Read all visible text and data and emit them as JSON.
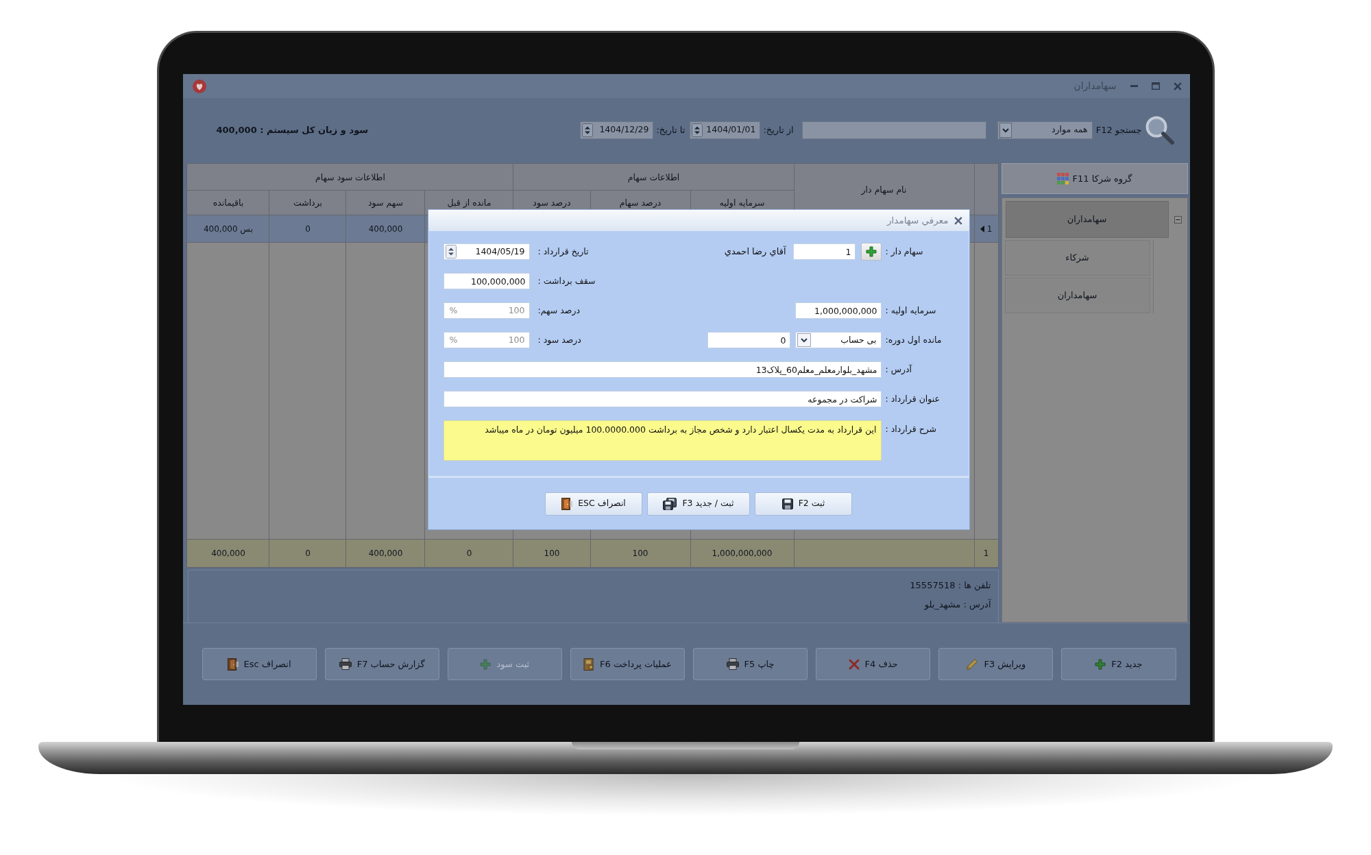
{
  "window": {
    "title": "سهامداران"
  },
  "toolbar": {
    "search_label": "جستجو F12",
    "scope": "همه موارد",
    "from_label": "از تاریخ:",
    "from_date": "1404/01/01",
    "to_label": "تا تاریخ:",
    "to_date": "1404/12/29",
    "total": "سود و زیان کل سیستم : 400,000"
  },
  "sidebar": {
    "header": "گروه شرکا F11",
    "items": [
      {
        "label": "سهامداران",
        "selected": true,
        "expanded": true,
        "children": [
          {
            "label": "شرکاء",
            "selected": false
          },
          {
            "label": "سهامداران",
            "selected": false
          }
        ]
      }
    ]
  },
  "table": {
    "name_column": "نام سهام دار",
    "groups": [
      {
        "label": "اطلاعات سهام",
        "columns": [
          "سرمایه اولیه",
          "درصد سهام",
          "درصد سود"
        ]
      },
      {
        "label": "اطلاعات سود سهام",
        "columns": [
          "مانده از قبل",
          "سهم سود",
          "برداشت",
          "باقیمانده"
        ]
      }
    ],
    "rows": [
      {
        "number": "1",
        "selected": true,
        "cells": [
          "400,000",
          "0",
          "400,000 بس"
        ]
      }
    ],
    "totals": {
      "number": "1",
      "cells": [
        "1,000,000,000",
        "100",
        "100",
        "0",
        "400,000",
        "0",
        "400,000"
      ]
    }
  },
  "info": [
    "تلفن ها : 15557518",
    "آدرس : مشهد_بلو"
  ],
  "actions": [
    {
      "label": "جدید F2",
      "kind": "add",
      "disabled": false
    },
    {
      "label": "ویرایش F3",
      "kind": "edit",
      "disabled": false
    },
    {
      "label": "حذف F4",
      "kind": "delete",
      "disabled": false
    },
    {
      "label": "چاپ F5",
      "kind": "print",
      "disabled": false
    },
    {
      "label": "عملیات پرداخت F6",
      "kind": "payment",
      "disabled": false
    },
    {
      "label": "ثبت سود",
      "kind": "add",
      "disabled": true
    },
    {
      "label": "گزارش حساب F7",
      "kind": "print",
      "disabled": false
    },
    {
      "label": "انصراف Esc",
      "kind": "exit",
      "disabled": false
    }
  ],
  "dialog": {
    "title": "معرفي سهامدار",
    "shareholder": {
      "label": "سهام دار :",
      "code": "1",
      "name": "آقاي رضا احمدي"
    },
    "contract_date": {
      "label": "تاریخ قرارداد :",
      "value": "1404/05/19"
    },
    "withdrawal_cap": {
      "label": "سقف برداشت :",
      "value": "100,000,000"
    },
    "initial_capital": {
      "label": "سرمایه اولیه :",
      "value": "1,000,000,000"
    },
    "share_percent": {
      "label": "درصد سهم:",
      "value": "100",
      "unit": "%",
      "disabled": true
    },
    "opening_balance": {
      "label": "مانده اول دوره:",
      "account_type": "بی حساب",
      "value": "0"
    },
    "profit_percent": {
      "label": "درصد سود :",
      "value": "100",
      "unit": "%",
      "disabled": true
    },
    "address": {
      "label": "آدرس :",
      "value": "مشهد_بلوارمعلم_معلم60_پلاک13"
    },
    "contract_title": {
      "label": "عنوان قرارداد :",
      "value": "شراکت در مجموعه"
    },
    "description": {
      "label": "شرح قرارداد :",
      "value": "این قرارداد به مدت یکسال اعتبار دارد و شخص مجاز به برداشت 100.0000.000 میلیون تومان در ماه میباشد"
    },
    "buttons": [
      {
        "label": "ثبت F2",
        "kind": "save"
      },
      {
        "label": "ثبت / جدید F3",
        "kind": "save_new"
      },
      {
        "label": "انصراف ESC",
        "kind": "exit"
      }
    ]
  }
}
